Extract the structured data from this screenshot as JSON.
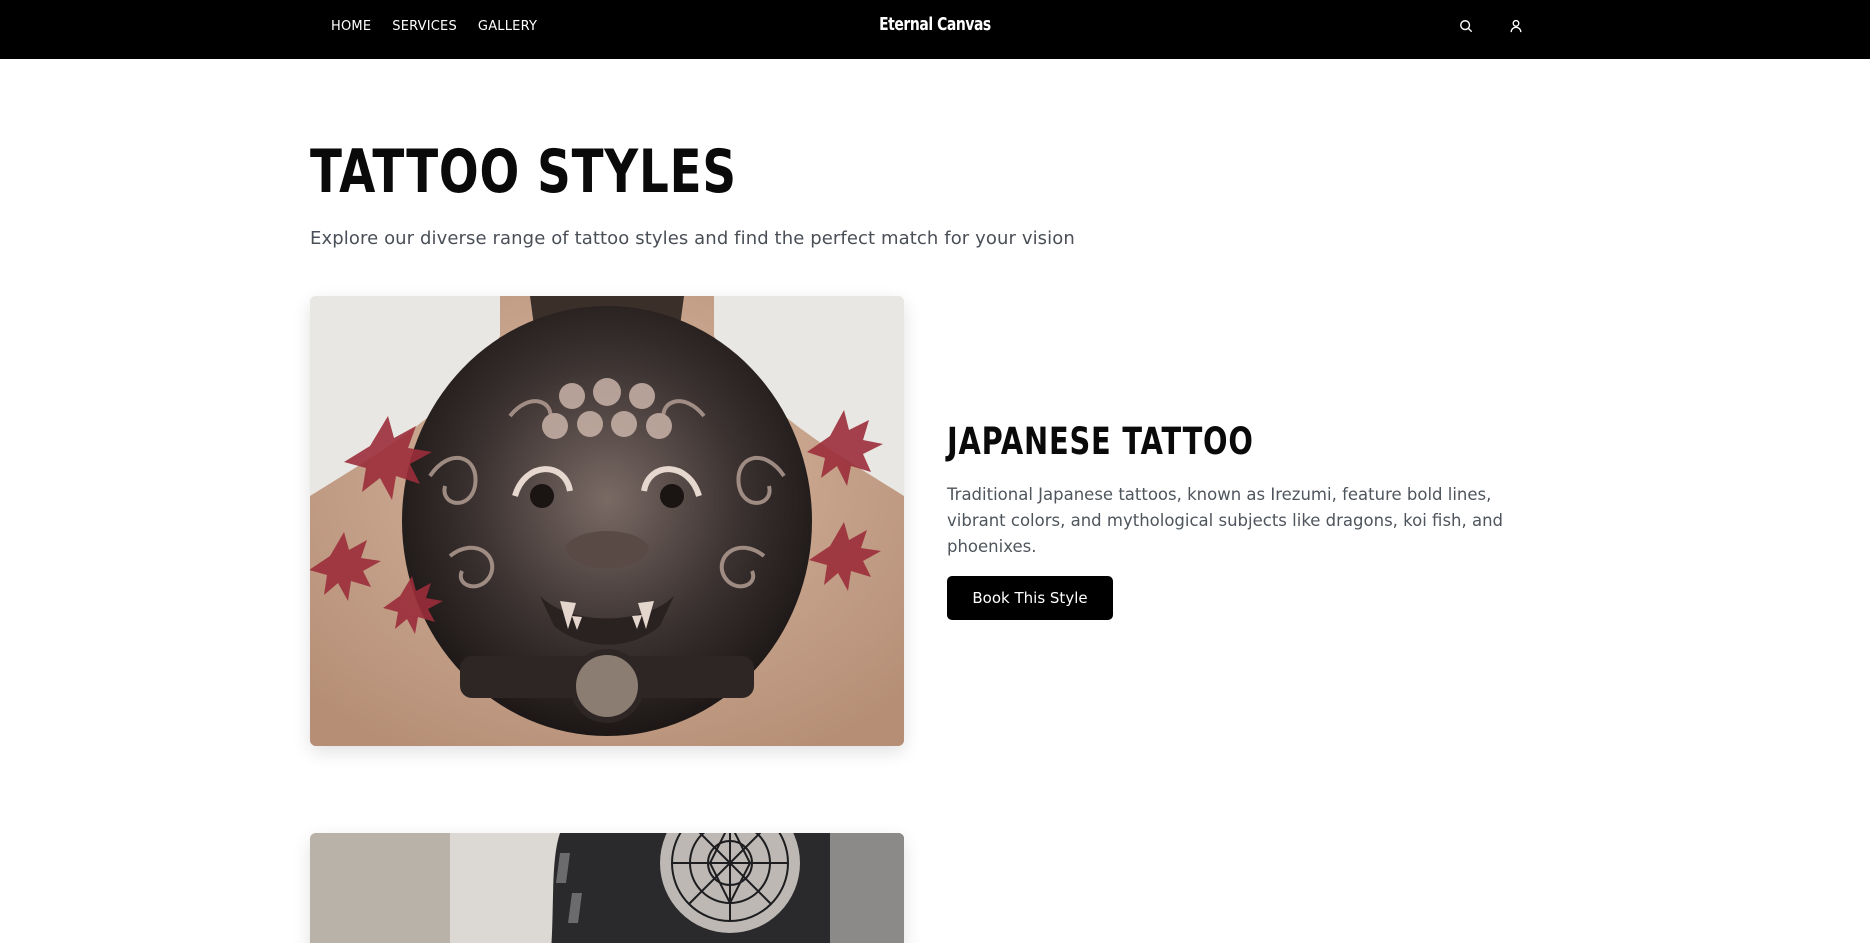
{
  "header": {
    "brand": "Eternal Canvas",
    "nav": [
      {
        "label": "HOME"
      },
      {
        "label": "SERVICES"
      },
      {
        "label": "GALLERY"
      }
    ],
    "icons": [
      "search-icon",
      "user-icon"
    ]
  },
  "main": {
    "title": "TATTOO STYLES",
    "subtitle": "Explore our diverse range of tattoo styles and find the perfect match for your vision",
    "styles": [
      {
        "name": "JAPANESE TATTOO",
        "description": "Traditional Japanese tattoos, known as Irezumi, feature bold lines, vibrant colors, and mythological subjects like dragons, koi fish, and phoenixes.",
        "button_label": "Book This Style"
      }
    ]
  },
  "colors": {
    "header_bg": "#000000",
    "text_primary": "#0a0a0a",
    "text_muted": "#4f555d",
    "button_bg": "#000000",
    "accent_leaf": "#9b2d3a"
  }
}
